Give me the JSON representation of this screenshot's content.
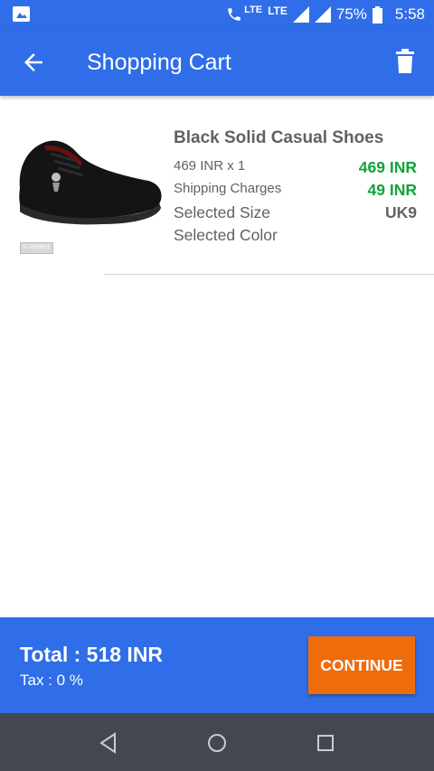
{
  "status_bar": {
    "volte_label": "LTE",
    "lte_label": "LTE",
    "battery": "75%",
    "time": "5:58",
    "icons": [
      "gallery-icon",
      "volte-call-icon",
      "signal-icon",
      "signal-icon",
      "battery-icon"
    ]
  },
  "app_bar": {
    "title": "Shopping Cart",
    "icons": [
      "back-arrow-icon",
      "trash-icon"
    ]
  },
  "cart": {
    "items": [
      {
        "name": "Black Solid Casual Shoes",
        "product_code": "P-1899661",
        "price_line": "469 INR x 1",
        "price_value": "469 INR",
        "shipping_label": "Shipping Charges",
        "shipping_value": "49 INR",
        "size_label": "Selected Size",
        "size_value": "UK9",
        "color_label": "Selected Color"
      }
    ]
  },
  "footer": {
    "total": "Total : 518 INR",
    "tax": "Tax : 0 %",
    "continue_label": "CONTINUE"
  },
  "colors": {
    "primary": "#2f6ee8",
    "accent": "#ef6c0b",
    "price_green": "#0fa43a",
    "nav_bar": "#434850"
  }
}
